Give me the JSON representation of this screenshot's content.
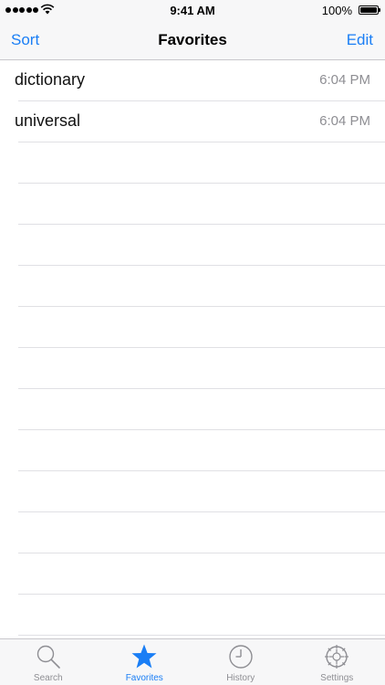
{
  "status_bar": {
    "time": "9:41 AM",
    "battery": "100%"
  },
  "nav": {
    "left_label": "Sort",
    "title": "Favorites",
    "right_label": "Edit"
  },
  "favorites": [
    {
      "word": "dictionary",
      "time": "6:04 PM"
    },
    {
      "word": "universal",
      "time": "6:04 PM"
    }
  ],
  "tabs": [
    {
      "label": "Search",
      "icon": "magnifier-icon",
      "active": false
    },
    {
      "label": "Favorites",
      "icon": "star-icon",
      "active": true
    },
    {
      "label": "History",
      "icon": "clock-icon",
      "active": false
    },
    {
      "label": "Settings",
      "icon": "gear-icon",
      "active": false
    }
  ],
  "colors": {
    "accent": "#1a7ef5",
    "inactive": "#8e8e93"
  }
}
